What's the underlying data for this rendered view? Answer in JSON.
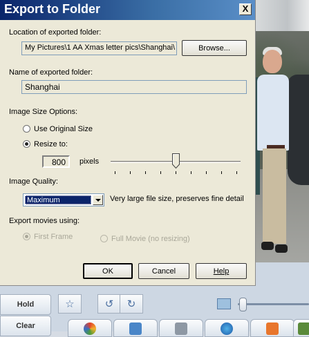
{
  "dialog": {
    "title": "Export to Folder",
    "close_label": "X",
    "location_label": "Location of exported folder:",
    "location_value": "My Pictures\\1  AA Xmas letter pics\\Shanghai\\",
    "browse_label": "Browse...",
    "name_label": "Name of exported folder:",
    "name_value": "Shanghai",
    "size_options_label": "Image Size Options:",
    "use_original_label": "Use Original Size",
    "resize_label": "Resize to:",
    "resize_value": "800",
    "pixels_label": "pixels",
    "slider_level": 0.5,
    "quality_label": "Image Quality:",
    "quality_selected": "Maximum",
    "quality_description": "Very large file size, preserves fine detail",
    "movies_label": "Export movies using:",
    "first_frame_label": "First Frame",
    "full_movie_label": "Full Movie (no resizing)",
    "ok_label": "OK",
    "cancel_label": "Cancel",
    "help_label": "Help"
  },
  "toolbar": {
    "hold_label": "Hold",
    "clear_label": "Clear",
    "icons": [
      "star-icon",
      "rotate-left-icon",
      "rotate-right-icon",
      "zoom-icon"
    ]
  },
  "colors": {
    "title_gradient_start": "#0a246a",
    "dialog_bg": "#ece9d8",
    "selection": "#0a246a"
  }
}
